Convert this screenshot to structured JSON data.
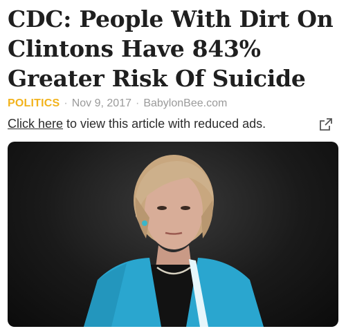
{
  "article": {
    "headline": "CDC: People With Dirt On Clintons Have 843% Greater Risk Of Suicide",
    "category": "POLITICS",
    "separator": "·",
    "date": "Nov 9, 2017",
    "source": "BabylonBee.com"
  },
  "reduced_ads": {
    "link_text": "Click here",
    "rest_text": "to view this article with reduced ads."
  },
  "icons": {
    "external": "external-link-icon"
  },
  "colors": {
    "category": "#f2b31c",
    "meta": "#9a9a9a",
    "headline": "#1f1f1f"
  }
}
